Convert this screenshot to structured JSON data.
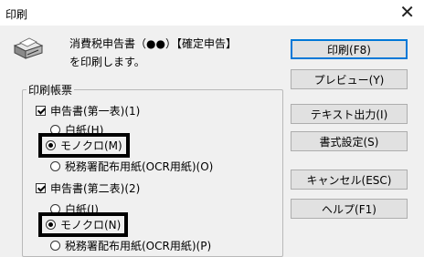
{
  "window": {
    "title": "印刷",
    "close_glyph": "✕"
  },
  "message": {
    "line1": "消費税申告書（●●）【確定申告】",
    "line2": "を印刷します。"
  },
  "group": {
    "legend": "印刷帳票",
    "form1": {
      "label": "申告書(第一表)(1)",
      "options": [
        "白紙(H)",
        "モノクロ(M)",
        "税務署配布用紙(OCR用紙)(O)"
      ],
      "selected": 1
    },
    "form2": {
      "label": "申告書(第二表)(2)",
      "options": [
        "白紙(J)",
        "モノクロ(N)",
        "税務署配布用紙(OCR用紙)(P)"
      ],
      "selected": 1
    }
  },
  "buttons": {
    "print": "印刷(F8)",
    "preview": "プレビュー(Y)",
    "text_output": "テキスト出力(I)",
    "format_settings": "書式設定(S)",
    "cancel": "キャンセル(ESC)",
    "help": "ヘルプ(F1)"
  },
  "icons": {
    "app": "printer-icon"
  },
  "colors": {
    "default_button_border": "#0078d7"
  }
}
